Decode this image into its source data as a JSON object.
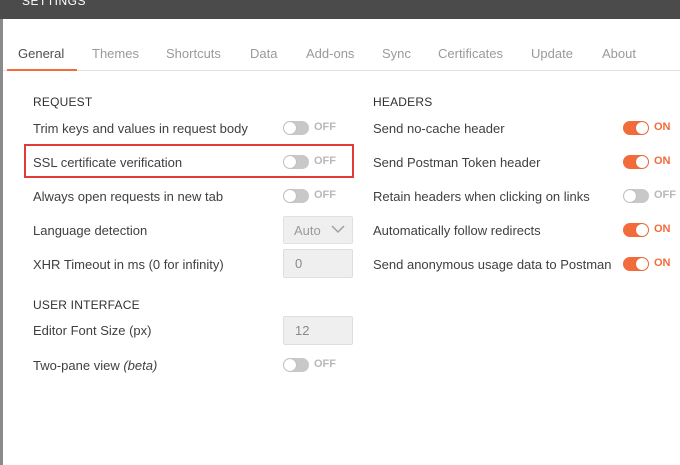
{
  "window": {
    "title": "SETTINGS"
  },
  "tabs": [
    {
      "label": "General"
    },
    {
      "label": "Themes"
    },
    {
      "label": "Shortcuts"
    },
    {
      "label": "Data"
    },
    {
      "label": "Add-ons"
    },
    {
      "label": "Sync"
    },
    {
      "label": "Certificates"
    },
    {
      "label": "Update"
    },
    {
      "label": "About"
    }
  ],
  "active_tab": "General",
  "request": {
    "title": "REQUEST",
    "trim": {
      "label": "Trim keys and values in request body",
      "state": "OFF"
    },
    "ssl": {
      "label": "SSL certificate verification",
      "state": "OFF"
    },
    "new_tab": {
      "label": "Always open requests in new tab",
      "state": "OFF"
    },
    "language": {
      "label": "Language detection",
      "value": "Auto"
    },
    "xhr": {
      "label": "XHR Timeout in ms (0 for infinity)",
      "value": "0"
    }
  },
  "ui": {
    "title": "USER INTERFACE",
    "font_size": {
      "label": "Editor Font Size (px)",
      "value": "12"
    },
    "two_pane": {
      "label": "Two-pane view",
      "label_suffix": "(beta)",
      "state": "OFF"
    }
  },
  "headers": {
    "title": "HEADERS",
    "no_cache": {
      "label": "Send no-cache header",
      "state": "ON"
    },
    "postman_token": {
      "label": "Send Postman Token header",
      "state": "ON"
    },
    "retain": {
      "label": "Retain headers when clicking on links",
      "state": "OFF"
    },
    "redirects": {
      "label": "Automatically follow redirects",
      "state": "ON"
    },
    "anonymous": {
      "label": "Send anonymous usage data to Postman",
      "state": "ON"
    }
  },
  "colors": {
    "accent": "#f26b3a",
    "highlight": "#e03a3a",
    "titlebar": "#4b4b4b"
  },
  "icons": {
    "select_chevron": "chevron-down-icon"
  }
}
